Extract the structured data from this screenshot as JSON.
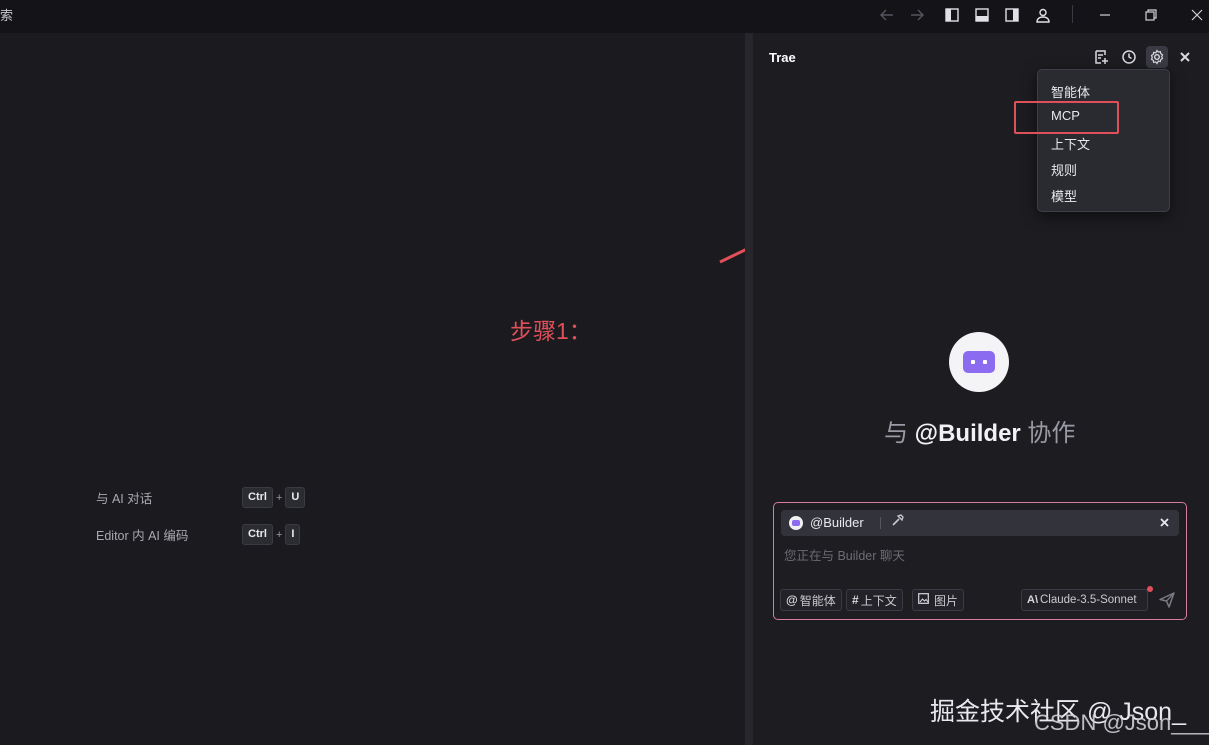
{
  "titlebar": {
    "title": "索",
    "icons": [
      "arrow-left-icon",
      "arrow-right-icon",
      "sidebar-left-icon",
      "panel-bottom-icon",
      "sidebar-right-icon",
      "account-icon",
      "minimize-icon",
      "restore-icon",
      "close-icon"
    ]
  },
  "editor": {
    "shortcuts": [
      {
        "label": "与 AI 对话",
        "keys": [
          "Ctrl",
          "U"
        ]
      },
      {
        "label": "Editor 内 AI 编码",
        "keys": [
          "Ctrl",
          "I"
        ]
      }
    ],
    "annotation": "步骤1："
  },
  "panel": {
    "title": "Trae",
    "menu": [
      "智能体",
      "MCP",
      "上下文",
      "规则",
      "模型"
    ],
    "collab_prefix": "与",
    "collab_name": "@Builder",
    "collab_suffix": "协作"
  },
  "chat": {
    "chip_name": "@Builder",
    "placeholder": "您正在与 Builder 聊天",
    "btn_agent": "智能体",
    "btn_context": "上下文",
    "btn_image": "图片",
    "model": "Claude-3.5-Sonnet"
  },
  "watermark": {
    "line1": "掘金技术社区 @ Json_",
    "line2": "CSDN @Json____"
  },
  "colors": {
    "accent": "#e0505a",
    "bot": "#8b6cf0",
    "panel_bg": "#1c1c21"
  }
}
